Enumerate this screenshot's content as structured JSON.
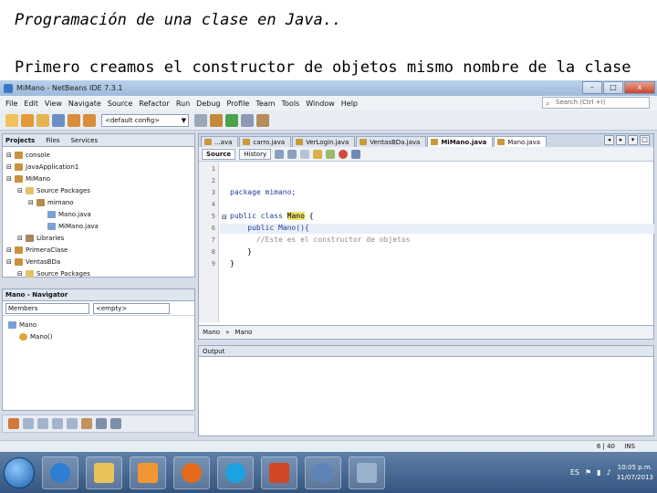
{
  "slide": {
    "title": "Programación de una clase en Java..",
    "subtitle": "Primero creamos el constructor de objetos mismo nombre de la clase"
  },
  "window": {
    "title": "MiMano - NetBeans IDE 7.3.1",
    "minimize": "–",
    "maximize": "□",
    "close": "x"
  },
  "menu": [
    "File",
    "Edit",
    "View",
    "Navigate",
    "Source",
    "Refactor",
    "Run",
    "Debug",
    "Profile",
    "Team",
    "Tools",
    "Window",
    "Help"
  ],
  "search": {
    "placeholder": "Search (Ctrl +I)"
  },
  "toolbar": {
    "config": "<default config>"
  },
  "projects_panel": {
    "tabs": [
      "Projects",
      "Files",
      "Services"
    ],
    "tree": [
      {
        "label": "console",
        "indent": 0,
        "icon": "project-icon"
      },
      {
        "label": "JavaApplication1",
        "indent": 0,
        "icon": "project-icon"
      },
      {
        "label": "MiMano",
        "indent": 0,
        "icon": "project-icon"
      },
      {
        "label": "Source Packages",
        "indent": 1,
        "icon": "folder-icon"
      },
      {
        "label": "mimano",
        "indent": 2,
        "icon": "package-icon"
      },
      {
        "label": "Mano.java",
        "indent": 3,
        "icon": "java-file-icon"
      },
      {
        "label": "MiMano.java",
        "indent": 3,
        "icon": "java-file-icon"
      },
      {
        "label": "Libraries",
        "indent": 1,
        "icon": "library-icon"
      },
      {
        "label": "PrimeraClase",
        "indent": 0,
        "icon": "project-icon"
      },
      {
        "label": "VentasBDa",
        "indent": 0,
        "icon": "project-icon"
      },
      {
        "label": "Source Packages",
        "indent": 1,
        "icon": "folder-icon"
      }
    ]
  },
  "navigator": {
    "title": "Mano - Navigator",
    "filter_label": "Members",
    "filter_value": "<empty>",
    "tree": [
      {
        "label": "Mano",
        "indent": 0
      },
      {
        "label": "Mano()",
        "indent": 1
      }
    ]
  },
  "editor": {
    "tabs": [
      {
        "label": "...ava",
        "active": false
      },
      {
        "label": "carro.java",
        "active": false
      },
      {
        "label": "VerLogin.java",
        "active": false
      },
      {
        "label": "VentasBDa.java",
        "active": false
      },
      {
        "label": "MiMano.java",
        "active": true
      },
      {
        "label": "Mano.java",
        "active": true
      }
    ],
    "modes": [
      "Source",
      "History"
    ],
    "line_numbers": [
      "1",
      "2",
      "3",
      "4",
      "5",
      "6",
      "7",
      "8",
      "9"
    ],
    "lines": [
      {
        "parts": []
      },
      {
        "parts": []
      },
      {
        "parts": [
          {
            "t": "package mimano;",
            "c": "kw"
          }
        ]
      },
      {
        "parts": []
      },
      {
        "parts": [
          {
            "t": "public class ",
            "c": "kw"
          },
          {
            "t": "Mano",
            "c": "hl-word"
          },
          {
            "t": " {",
            "c": ""
          }
        ]
      },
      {
        "parts": [
          {
            "t": "    public Mano(){",
            "c": "kw"
          }
        ]
      },
      {
        "parts": [
          {
            "t": "      //Este es el constructor de objetos",
            "c": "comment"
          }
        ]
      },
      {
        "parts": [
          {
            "t": "    }",
            "c": ""
          }
        ]
      },
      {
        "parts": [
          {
            "t": "}",
            "c": ""
          }
        ]
      }
    ],
    "breadcrumbs": [
      "Mano",
      "Mano"
    ]
  },
  "output": {
    "title": "Output"
  },
  "status": {
    "position": "6 | 40",
    "mode": "INS"
  },
  "taskbar": {
    "apps": [
      "start-icon",
      "ie-icon",
      "explorer-icon",
      "media-player-icon",
      "firefox-icon",
      "skype-icon",
      "powerpoint-icon",
      "netbeans-icon",
      "virtualbox-icon"
    ],
    "lang": "ES",
    "time": "10:05 p.m.",
    "date": "31/07/2013"
  },
  "colors": {
    "keyword": "#1e3e9c",
    "comment": "#8c8c8c",
    "highlight": "#f4e46c",
    "taskbar": "#34557f"
  }
}
